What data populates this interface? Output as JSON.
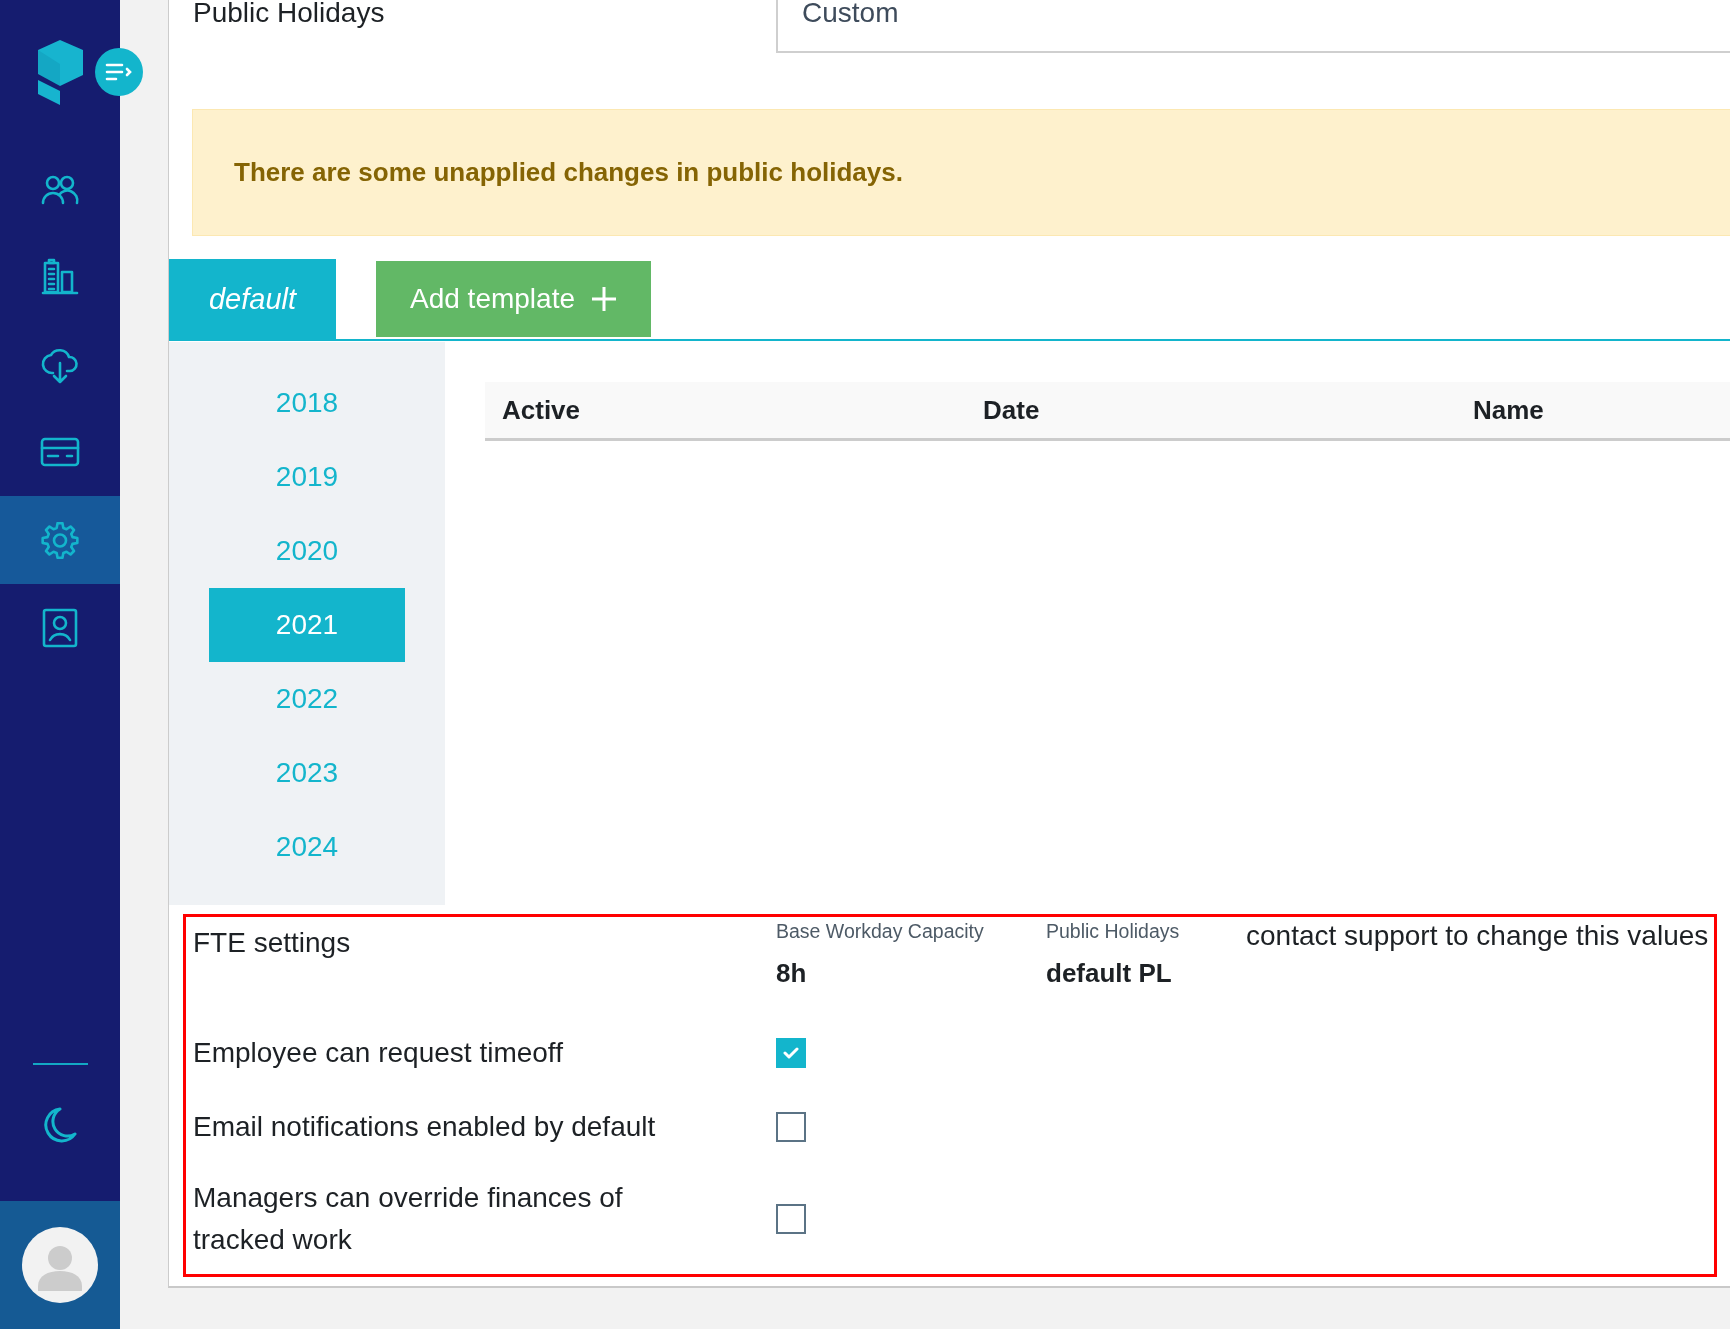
{
  "sidebar": {
    "items": [
      {
        "selected": false
      },
      {
        "selected": false
      },
      {
        "selected": false
      },
      {
        "selected": false
      },
      {
        "selected": true
      },
      {
        "selected": false
      }
    ]
  },
  "public_holidays": {
    "label": "Public Holidays",
    "select": {
      "value": "Custom"
    }
  },
  "alert": {
    "message": "There are some unapplied changes in public holidays."
  },
  "tabs": [
    {
      "label": "default",
      "selected": true
    }
  ],
  "add_template_button": {
    "label": "Add template"
  },
  "years": [
    {
      "label": "2018",
      "selected": false
    },
    {
      "label": "2019",
      "selected": false
    },
    {
      "label": "2020",
      "selected": false
    },
    {
      "label": "2021",
      "selected": true
    },
    {
      "label": "2022",
      "selected": false
    },
    {
      "label": "2023",
      "selected": false
    },
    {
      "label": "2024",
      "selected": false
    }
  ],
  "table": {
    "columns": [
      "Active",
      "Date",
      "Name"
    ]
  },
  "fte_settings": {
    "highlighted": true,
    "title": "FTE settings",
    "fields": [
      {
        "label": "Base Workday Capacity",
        "value": "8h"
      },
      {
        "label": "Public Holidays",
        "value": "default PL"
      }
    ],
    "note": "contact support to change this values",
    "options": [
      {
        "label": "Employee can request timeoff",
        "checked": true
      },
      {
        "label": "Email notifications enabled by default",
        "checked": false
      },
      {
        "label": "Managers can override finances of tracked work",
        "checked": false
      }
    ]
  }
}
